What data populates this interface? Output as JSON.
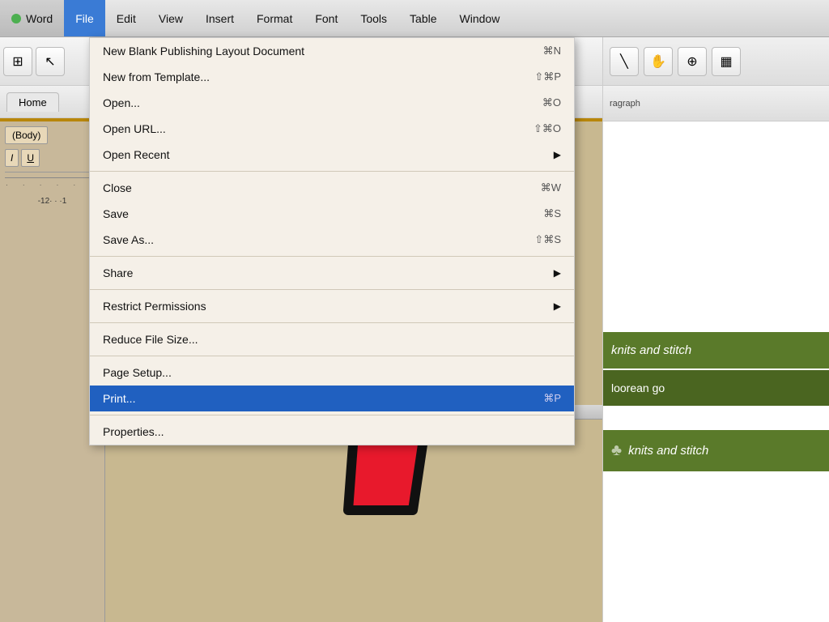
{
  "menubar": {
    "items": [
      {
        "label": "Word",
        "id": "word"
      },
      {
        "label": "File",
        "id": "file",
        "active": true
      },
      {
        "label": "Edit",
        "id": "edit"
      },
      {
        "label": "View",
        "id": "view"
      },
      {
        "label": "Insert",
        "id": "insert"
      },
      {
        "label": "Format",
        "id": "format"
      },
      {
        "label": "Font",
        "id": "font"
      },
      {
        "label": "Tools",
        "id": "tools"
      },
      {
        "label": "Table",
        "id": "table"
      },
      {
        "label": "Window",
        "id": "window"
      }
    ]
  },
  "toolbar": {
    "font_selector": "(Body)"
  },
  "home_tab": "Home",
  "dropdown": {
    "items": [
      {
        "label": "New Blank Publishing Layout Document",
        "shortcut": "⌘N",
        "has_arrow": false,
        "highlighted": false,
        "id": "new-blank"
      },
      {
        "label": "New from Template...",
        "shortcut": "⇧⌘P",
        "has_arrow": false,
        "highlighted": false,
        "id": "new-template"
      },
      {
        "label": "Open...",
        "shortcut": "⌘O",
        "has_arrow": false,
        "highlighted": false,
        "id": "open"
      },
      {
        "label": "Open URL...",
        "shortcut": "⇧⌘O",
        "has_arrow": false,
        "highlighted": false,
        "id": "open-url"
      },
      {
        "label": "Open Recent",
        "shortcut": "",
        "has_arrow": true,
        "highlighted": false,
        "id": "open-recent"
      },
      {
        "divider": true
      },
      {
        "label": "Close",
        "shortcut": "⌘W",
        "has_arrow": false,
        "highlighted": false,
        "id": "close"
      },
      {
        "label": "Save",
        "shortcut": "⌘S",
        "has_arrow": false,
        "highlighted": false,
        "id": "save"
      },
      {
        "label": "Save As...",
        "shortcut": "⇧⌘S",
        "has_arrow": false,
        "highlighted": false,
        "id": "save-as"
      },
      {
        "divider": true
      },
      {
        "label": "Share",
        "shortcut": "",
        "has_arrow": true,
        "highlighted": false,
        "id": "share"
      },
      {
        "divider": true
      },
      {
        "label": "Restrict Permissions",
        "shortcut": "",
        "has_arrow": true,
        "highlighted": false,
        "id": "restrict"
      },
      {
        "divider": true
      },
      {
        "label": "Reduce File Size...",
        "shortcut": "",
        "has_arrow": false,
        "highlighted": false,
        "id": "reduce"
      },
      {
        "divider": true
      },
      {
        "label": "Page Setup...",
        "shortcut": "",
        "has_arrow": false,
        "highlighted": false,
        "id": "page-setup"
      },
      {
        "label": "Print...",
        "shortcut": "⌘P",
        "has_arrow": false,
        "highlighted": true,
        "id": "print"
      },
      {
        "divider": true
      },
      {
        "label": "Properties...",
        "shortcut": "",
        "has_arrow": false,
        "highlighted": false,
        "id": "properties"
      }
    ]
  },
  "doc_preview": {
    "band1": "knits and stitch",
    "band2": "loorean go",
    "band3": "knits and stitch"
  },
  "paragraph_label": "ragraph",
  "toolbar_icons": {
    "grid": "⊞",
    "cursor": "↖",
    "hand": "✋",
    "plus_circle": "⊕",
    "sidebar_icon": "▦"
  }
}
